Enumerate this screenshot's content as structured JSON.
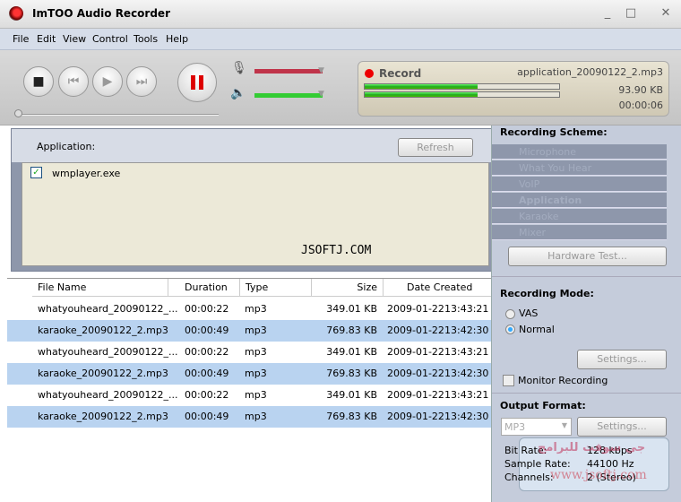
{
  "window": {
    "title": "ImTOO Audio Recorder",
    "min": "⇲",
    "max": "⇲",
    "close": "✕"
  },
  "menu": [
    "File",
    "Edit",
    "View",
    "Control",
    "Tools",
    "Help"
  ],
  "status": {
    "label": "Record",
    "file": "application_20090122_2.mp3",
    "size": "93.90 KB",
    "time": "00:00:06",
    "level_left": 0.58,
    "level_right": 0.58
  },
  "volume": {
    "mic": 1.0,
    "speaker": 1.0
  },
  "colors": {
    "record": "#e00000",
    "mic_bar": "#c0344a",
    "speaker_bar": "#3c3",
    "selected_row": "#b9d3f0"
  },
  "application": {
    "label": "Application:",
    "refresh": "Refresh",
    "items": [
      {
        "name": "wmplayer.exe",
        "checked": true
      }
    ],
    "watermark": "JSOFTJ.COM"
  },
  "scheme": {
    "title": "Recording Scheme:",
    "items": [
      "Microphone",
      "What You Hear",
      "VoIP",
      "Application",
      "Karaoke",
      "Mixer"
    ],
    "selected": "Application",
    "hardware_test": "Hardware Test..."
  },
  "mode": {
    "title": "Recording Mode:",
    "options": [
      "VAS",
      "Normal"
    ],
    "selected": "Normal",
    "settings": "Settings...",
    "monitor": "Monitor Recording"
  },
  "output": {
    "title": "Output Format:",
    "format": "MP3",
    "settings": "Settings...",
    "bitrate_label": "Bit Rate:",
    "bitrate": "128 kbps",
    "sample_label": "Sample Rate:",
    "sample": "44100 Hz",
    "channels_label": "Channels:",
    "channels": "2 (Stereo)"
  },
  "table": {
    "headers": [
      "File Name",
      "Duration",
      "Type",
      "Size",
      "Date Created"
    ],
    "rows": [
      [
        "whatyouheard_20090122_...",
        "00:00:22",
        "mp3",
        "349.01 KB",
        "2009-01-22",
        "13:43:21"
      ],
      [
        "karaoke_20090122_2.mp3",
        "00:00:49",
        "mp3",
        "769.83 KB",
        "2009-01-22",
        "13:42:30"
      ],
      [
        "whatyouheard_20090122_...",
        "00:00:22",
        "mp3",
        "349.01 KB",
        "2009-01-22",
        "13:43:21"
      ],
      [
        "karaoke_20090122_2.mp3",
        "00:00:49",
        "mp3",
        "769.83 KB",
        "2009-01-22",
        "13:42:30"
      ],
      [
        "whatyouheard_20090122_...",
        "00:00:22",
        "mp3",
        "349.01 KB",
        "2009-01-22",
        "13:43:21"
      ],
      [
        "karaoke_20090122_2.mp3",
        "00:00:49",
        "mp3",
        "769.83 KB",
        "2009-01-22",
        "13:42:30"
      ]
    ]
  },
  "overlay": {
    "arabic": "جي سوفت للبرامج",
    "url": "www.jsoftj.com"
  }
}
